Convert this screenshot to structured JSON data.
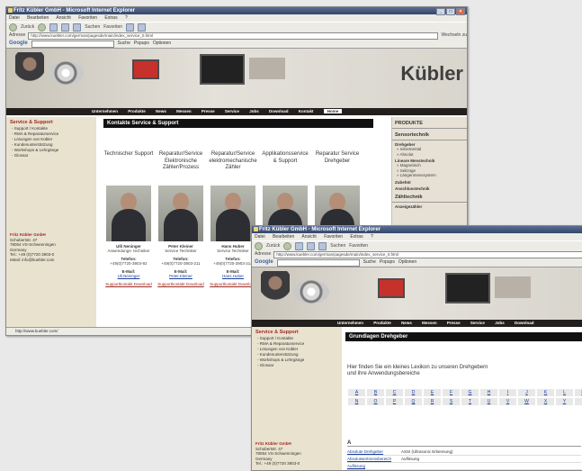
{
  "back": {
    "title": "Fritz Kübler GmbH - Microsoft Internet Explorer",
    "menu": [
      "Datei",
      "Bearbeiten",
      "Ansicht",
      "Favoriten",
      "Extras",
      "?"
    ],
    "toolbar_text": [
      "Zurück",
      "Suchen",
      "Favoriten"
    ],
    "address_label": "Adresse",
    "address": "http://www.kuebler.com/german/pagesde/main/index_service_0.html",
    "go_label": "Wechseln zu",
    "google": "Google",
    "google_items": [
      "Suche",
      "Popups",
      "Optionen"
    ],
    "brand": "Kübler",
    "nav": [
      "Unternehmen",
      "Produkte",
      "News",
      "Messen",
      "Presse",
      "Service",
      "Jobs",
      "Download",
      "Kontakt",
      "Home"
    ],
    "sidebar": {
      "heading": "Service & Support",
      "items": [
        "- Support / Kontakte",
        "- RMA & Reparaturservice",
        "- Lösungen von Kübler",
        "- Kundenunterstützung",
        "- Workshops & Lehrgänge",
        "- Glossar"
      ],
      "company": "Fritz Kübler GmbH",
      "address": [
        "Schubertstr. 47",
        "78054 VS-Schwenningen",
        "Germany",
        "Tel.: +49 (0)7720 3903-0",
        "eMail: info@kuebler.com"
      ]
    },
    "section_title": "Kontakte Service & Support",
    "contacts": [
      {
        "dept": "Technischer Support",
        "name": "Ulli Neninger",
        "role": "Anwendungs- techniker",
        "tel_label": "Telefon:",
        "tel": "+49(0)7720-3903-92",
        "mail_label": "E-Mail:",
        "mail": "Uli.Neninger",
        "link": "Supportkontakt Download"
      },
      {
        "dept": "Reparatur/Service Elektronische Zähler/Prozess",
        "name": "Peter Kleiner",
        "role": "Service Techniker",
        "tel_label": "Telefon:",
        "tel": "+49(0)7720-3903-211",
        "mail_label": "E-Mail:",
        "mail": "Peter.Kleiner",
        "link": "Supportkontakt Download"
      },
      {
        "dept": "Reparatur/Service elektromechanische Zähler",
        "name": "Hans Huber",
        "role": "Service Techniker",
        "tel_label": "Telefon:",
        "tel": "+49(0)7720-3903-214",
        "mail_label": "E-Mail:",
        "mail": "Hans.Huber",
        "link": "Supportkontakt Download"
      },
      {
        "dept": "Applikationsservice & Support",
        "name": "",
        "role": "",
        "tel_label": "",
        "tel": "",
        "mail_label": "",
        "mail": "",
        "link": ""
      },
      {
        "dept": "Reparatur Service Drehgeber",
        "name": "",
        "role": "",
        "tel_label": "",
        "tel": "",
        "mail_label": "",
        "mail": "",
        "link": ""
      }
    ],
    "right": {
      "heading": "PRODUKTE",
      "subheading": "Sensortechnik",
      "groups": [
        {
          "title": "Drehgeber",
          "items": [
            "» Inkremental",
            "» Absolut"
          ]
        },
        {
          "title": "Lineare Messtechnik",
          "items": [
            "» Magnetisch",
            "» Seilzüge",
            "» Längenmesssystem"
          ]
        },
        {
          "title": "Zubehör",
          "items": []
        },
        {
          "title": "Anschlusstechnik",
          "items": []
        }
      ],
      "heading2": "Zähltechnik",
      "sub2": "Anzeigezähler"
    },
    "status": "http://www.kuebler.com/"
  },
  "front": {
    "title": "Fritz Kübler GmbH - Microsoft Internet Explorer",
    "menu": [
      "Datei",
      "Bearbeiten",
      "Ansicht",
      "Favoriten",
      "Extras",
      "?"
    ],
    "toolbar_text": [
      "Zurück",
      "Suchen",
      "Favoriten"
    ],
    "address_label": "Adresse",
    "address": "http://www.kuebler.com/german/pagesde/main/index_service_0.html",
    "google": "Google",
    "google_items": [
      "Suche",
      "Popups",
      "Optionen"
    ],
    "nav": [
      "Unternehmen",
      "Produkte",
      "News",
      "Messen",
      "Presse",
      "Service",
      "Jobs",
      "Download"
    ],
    "sidebar": {
      "heading": "Service & Support",
      "items": [
        "- Support / Kontakte",
        "- RMA & Reparaturservice",
        "- Lösungen von Kübler",
        "- Kundenunterstützung",
        "- Workshops & Lehrgänge",
        "- Glossar"
      ],
      "company": "Fritz Kübler GmbH",
      "address": [
        "Schubertstr. 47",
        "78054 VS-Schwenningen",
        "Germany",
        "Tel.: +49 (0)7720 3903-0"
      ]
    },
    "section_title": "Grundlagen Drehgeber",
    "intro": "Hier finden Sie ein kleines Lexikon zu unseren Drehgebern und ihre Anwendungsbereiche",
    "letters": [
      "A",
      "B",
      "C",
      "D",
      "E",
      "F",
      "G",
      "H",
      "I",
      "J",
      "K",
      "L",
      "M",
      "N",
      "O",
      "P",
      "Q",
      "R",
      "S",
      "T",
      "U",
      "V",
      "W",
      "X",
      "Y",
      "Z"
    ],
    "glossary_letter": "A",
    "glossary": [
      {
        "term": "Absolute Drehgeber",
        "desc": "ASSI (Ultrasonic Erkennung)"
      },
      {
        "term": "Absolutwertmessbereich",
        "desc": "Auflösung"
      },
      {
        "term": "Auflösung",
        "desc": ""
      }
    ]
  }
}
